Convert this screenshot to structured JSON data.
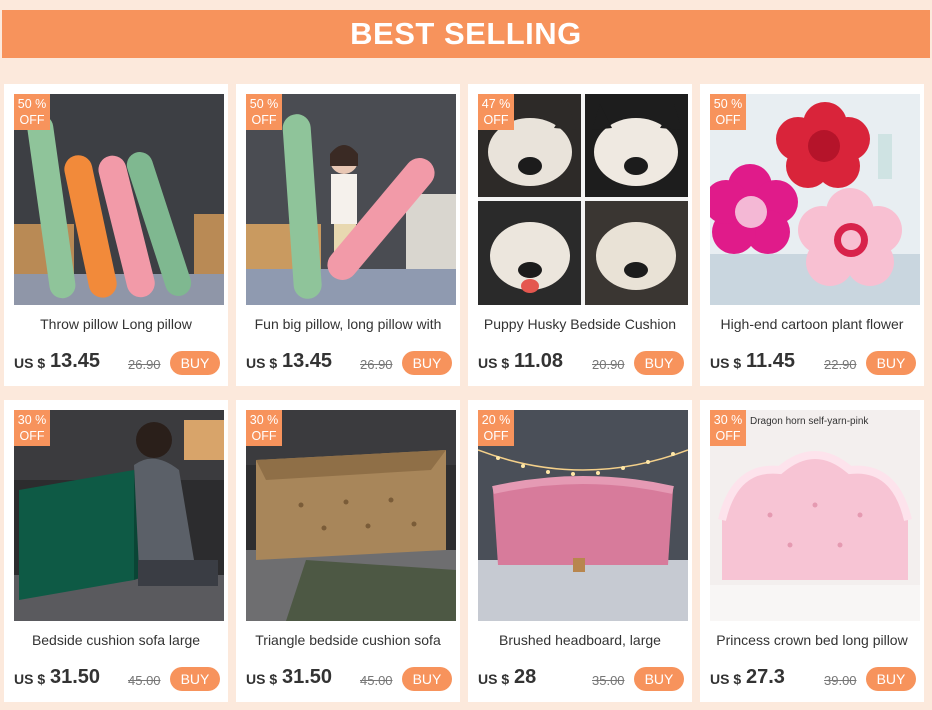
{
  "banner": {
    "title": "BEST SELLING"
  },
  "products": [
    {
      "discount": "50 %\nOFF",
      "name": "Throw pillow   Long pillow",
      "currency": "US $",
      "price": "13.45",
      "old_price": "26.90",
      "buy": "BUY"
    },
    {
      "discount": "50 %\nOFF",
      "name": "Fun big pillow, long pillow with",
      "currency": "US $",
      "price": "13.45",
      "old_price": "26.90",
      "buy": "BUY"
    },
    {
      "discount": "47 %\nOFF",
      "name": "Puppy Husky Bedside Cushion",
      "currency": "US $",
      "price": "11.08",
      "old_price": "20.90",
      "buy": "BUY"
    },
    {
      "discount": "50 %\nOFF",
      "name": "High-end cartoon plant flower",
      "currency": "US $",
      "price": "11.45",
      "old_price": "22.90",
      "buy": "BUY"
    },
    {
      "discount": "30 %\nOFF",
      "name": "Bedside cushion sofa large",
      "currency": "US $",
      "price": "31.50",
      "old_price": "45.00",
      "buy": "BUY"
    },
    {
      "discount": "30 %\nOFF",
      "name": "Triangle bedside cushion sofa",
      "currency": "US $",
      "price": "31.50",
      "old_price": "45.00",
      "buy": "BUY"
    },
    {
      "discount": "20 %\nOFF",
      "name": "Brushed headboard, large",
      "currency": "US $",
      "price": "28",
      "old_price": "35.00",
      "buy": "BUY"
    },
    {
      "discount": "30 %\nOFF",
      "name": "Princess crown bed long pillow",
      "currency": "US $",
      "price": "27.3",
      "old_price": "39.00",
      "buy": "BUY",
      "image_caption": "Dragon horn self-yarn-pink"
    }
  ]
}
